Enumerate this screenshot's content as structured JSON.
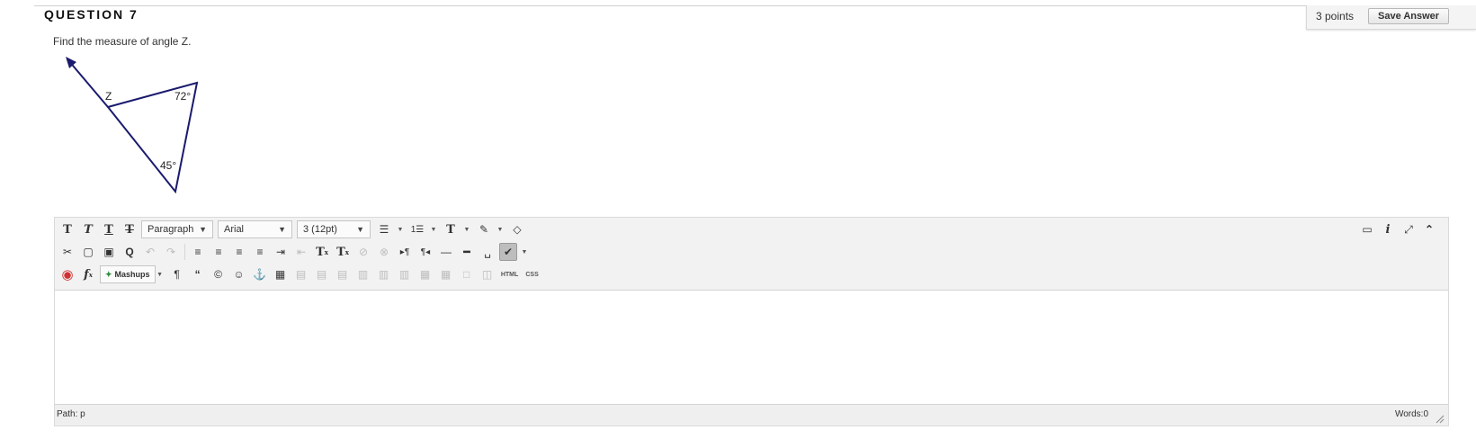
{
  "question": {
    "header": "QUESTION 7",
    "points": "3 points",
    "save_label": "Save Answer",
    "text": "Find the measure of angle Z."
  },
  "figure": {
    "vertex_label": "Z",
    "angle_top": "72°",
    "angle_bottom": "45°",
    "line_color": "#1a1a6e"
  },
  "toolbar": {
    "block_format": "Paragraph",
    "font_family": "Arial",
    "font_size": "3 (12pt)",
    "mashups": "Mashups",
    "html_label": "HTML",
    "css_label": "CSS"
  },
  "status": {
    "path_label": "Path:",
    "path_value": "p",
    "words_label": "Words:",
    "words_value": "0"
  }
}
